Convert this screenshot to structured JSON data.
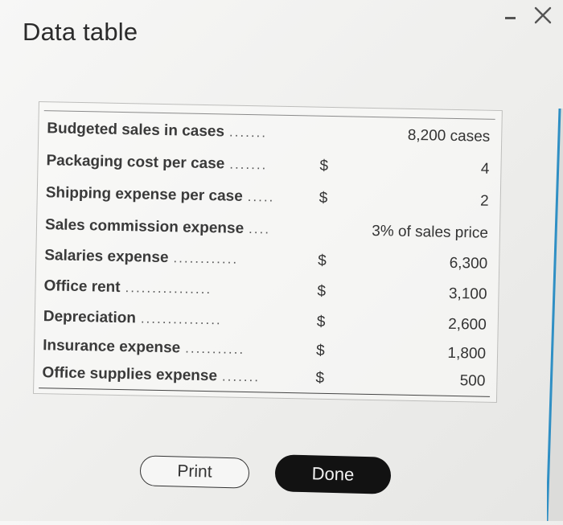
{
  "dialog": {
    "title": "Data table"
  },
  "table": {
    "rows": [
      {
        "label": "Budgeted sales in cases",
        "leader": ".......",
        "dollar": "",
        "value": "8,200 cases"
      },
      {
        "label": "Packaging cost per case",
        "leader": ".......",
        "dollar": "$",
        "value": "4"
      },
      {
        "label": "Shipping expense per case",
        "leader": ".....",
        "dollar": "$",
        "value": "2"
      },
      {
        "label": "Sales commission expense",
        "leader": "....",
        "dollar": "",
        "value": "3% of sales price"
      },
      {
        "label": "Salaries expense",
        "leader": "............",
        "dollar": "$",
        "value": "6,300"
      },
      {
        "label": "Office rent",
        "leader": "................",
        "dollar": "$",
        "value": "3,100"
      },
      {
        "label": "Depreciation",
        "leader": "...............",
        "dollar": "$",
        "value": "2,600"
      },
      {
        "label": "Insurance expense",
        "leader": "...........",
        "dollar": "$",
        "value": "1,800"
      },
      {
        "label": "Office supplies expense",
        "leader": ".......",
        "dollar": "$",
        "value": "500"
      }
    ]
  },
  "buttons": {
    "print_label": "Print",
    "done_label": "Done"
  },
  "icons": {
    "minimize": "minimize-icon",
    "close": "close-icon"
  },
  "colors": {
    "done_button_bg": "#121212",
    "background": "#efefed",
    "right_edge_accent": "#2f8fc4"
  }
}
